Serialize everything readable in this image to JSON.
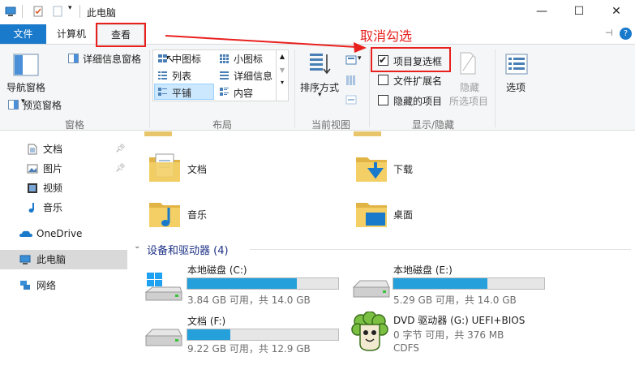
{
  "window": {
    "title": "此电脑"
  },
  "tabs": {
    "file": "文件",
    "computer": "计算机",
    "view": "查看"
  },
  "ribbon": {
    "pane": {
      "nav_pane": "导航窗格",
      "preview_pane": "预览窗格",
      "details_pane": "详细信息窗格",
      "group": "窗格"
    },
    "layout": {
      "items": [
        "中图标",
        "小图标",
        "列表",
        "详细信息",
        "平铺",
        "内容"
      ],
      "group": "布局"
    },
    "current_view": {
      "sort_by": "排序方式",
      "group": "当前视图"
    },
    "show_hide": {
      "item_checkboxes": "项目复选框",
      "file_extensions": "文件扩展名",
      "hidden_items": "隐藏的项目",
      "hide_selected_1": "隐藏",
      "hide_selected_2": "所选项目",
      "group": "显示/隐藏",
      "item_checkboxes_checked": true,
      "file_extensions_checked": false,
      "hidden_items_checked": false
    },
    "options": "选项"
  },
  "annotation": {
    "text": "取消勾选"
  },
  "nav": {
    "items": [
      "文档",
      "图片",
      "视频",
      "音乐",
      "OneDrive",
      "此电脑",
      "网络"
    ]
  },
  "folders": [
    "文档",
    "下载",
    "音乐",
    "桌面"
  ],
  "devices": {
    "header": "设备和驱动器 (4)",
    "drives": [
      {
        "name": "本地磁盘 (C:)",
        "info": "3.84 GB 可用，共 14.0 GB",
        "used_fraction": 0.726
      },
      {
        "name": "本地磁盘 (E:)",
        "info": "5.29 GB 可用，共 14.0 GB",
        "used_fraction": 0.622
      },
      {
        "name": "文档 (F:)",
        "info": "9.22 GB 可用，共 12.9 GB",
        "used_fraction": 0.285
      },
      {
        "name": "DVD 驱动器 (G:) UEFI+BIOS",
        "info": "0 字节 可用，共 376 MB",
        "fs": "CDFS"
      }
    ]
  },
  "colors": {
    "accent": "#1979ca",
    "annotation": "#e8211f",
    "drive_fill": "#26a0da"
  }
}
